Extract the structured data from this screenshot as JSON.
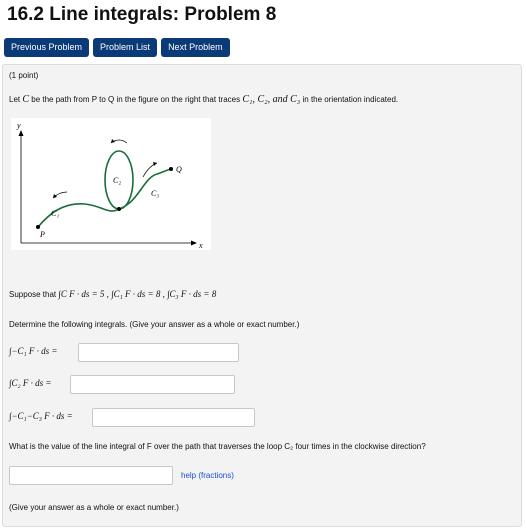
{
  "header": {
    "title": "16.2 Line integrals: Problem 8"
  },
  "nav": {
    "previous": "Previous Problem",
    "list": "Problem List",
    "next": "Next Problem"
  },
  "problem": {
    "points": "(1 point)",
    "statement_prefix": "Let ",
    "statement_C": "C",
    "statement_mid": " be the path from P to Q in the figure on the right that traces ",
    "statement_curves": "C₁, C₂, and C₃",
    "statement_suffix": " in the orientation indicated.",
    "figure": {
      "y": "y",
      "x": "x",
      "P": "P",
      "Q": "Q",
      "c1": "C₁",
      "c2": "C₂",
      "c3": "C₃"
    },
    "given_prefix": "Suppose that ",
    "given": "∫C F · ds = 5 ,  ∫C₁ F · ds = 8 ,  ∫C₃ F · ds = 8",
    "determine": "Determine the following integrals. (Give your answer as a whole or exact number.)",
    "q1_label": "∫−C₁ F · ds =",
    "q1_value": "",
    "q2_label": "∫C₂ F · ds =",
    "q2_value": "",
    "q3_label": "∫−C₁−C₃ F · ds =",
    "q3_value": "",
    "q4_text": "What is the value of the line integral of F over the path that traverses the loop C₂ four times in the clockwise direction?",
    "q4_value": "",
    "help_link": "help (fractions)",
    "footer_note": "(Give your answer as a whole or exact number.)"
  }
}
